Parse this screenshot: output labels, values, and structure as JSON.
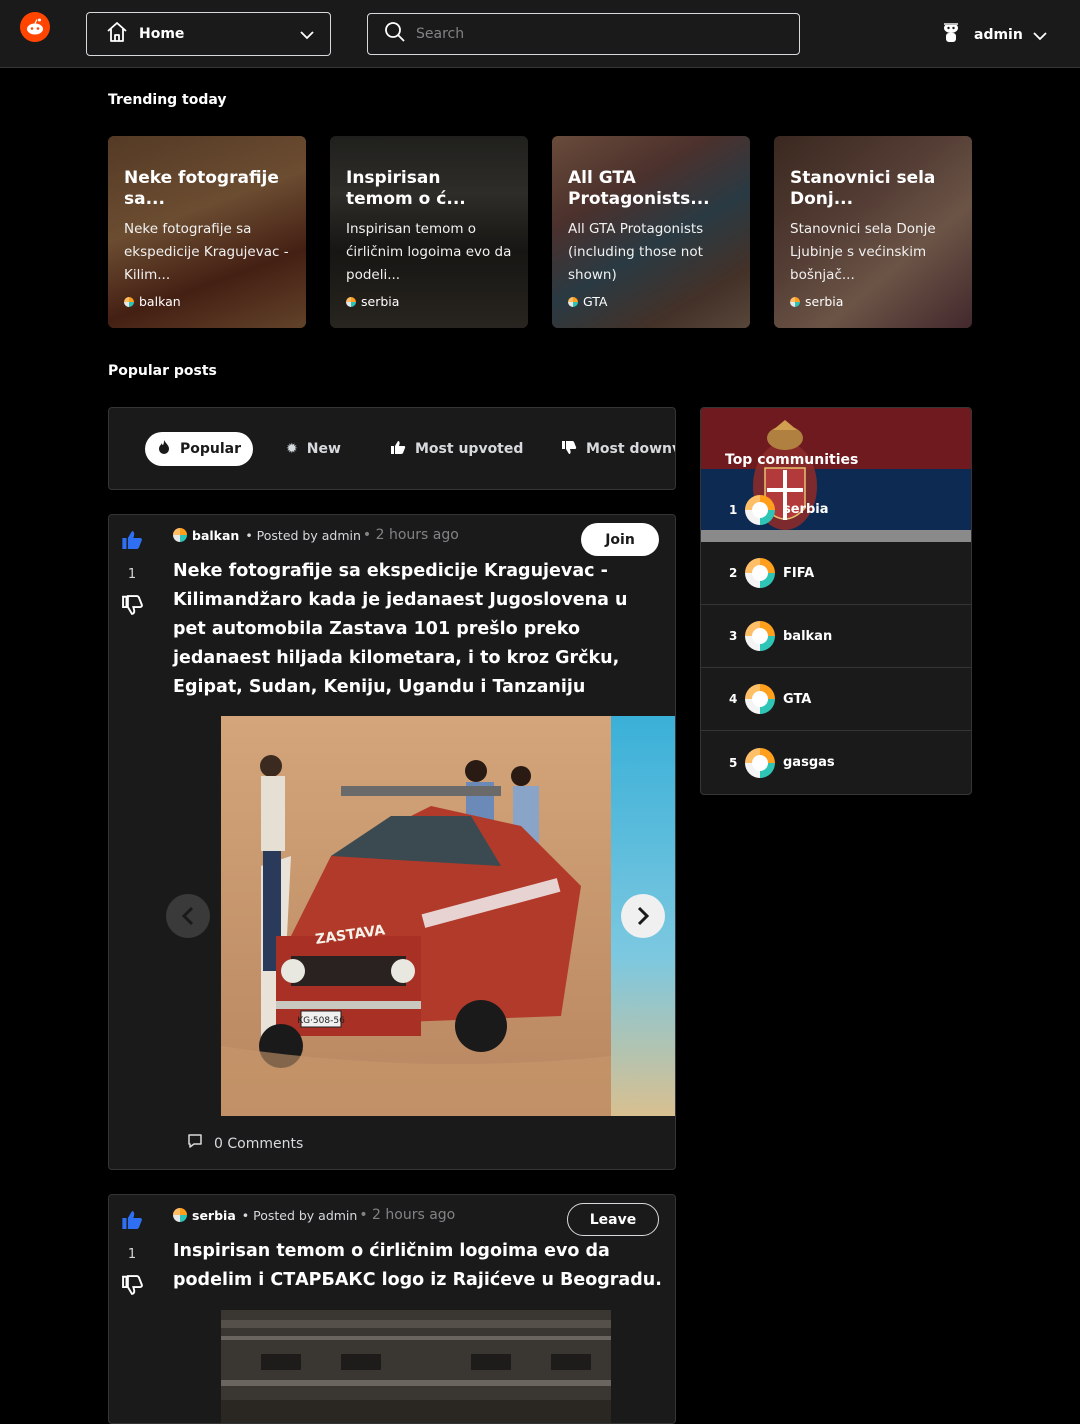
{
  "header": {
    "feed_label": "Home",
    "search_placeholder": "Search",
    "username": "admin"
  },
  "trending": {
    "title": "Trending today",
    "cards": [
      {
        "title": "Neke fotografije sa...",
        "desc": "Neke fotografije sa ekspedicije Kragujevac - Kilim...",
        "sub": "balkan"
      },
      {
        "title": "Inspirisan temom o ć...",
        "desc": "Inspirisan temom o ćirličnim logoima evo da podeli...",
        "sub": "serbia"
      },
      {
        "title": "All GTA Protagonists...",
        "desc": "All GTA Protagonists (including those not shown)",
        "sub": "GTA"
      },
      {
        "title": "Stanovnici sela Donj...",
        "desc": "Stanovnici sela Donje Ljubinje s većinskim bošnjač...",
        "sub": "serbia"
      }
    ]
  },
  "popular": {
    "title": "Popular posts",
    "tabs": [
      "Popular",
      "New",
      "Most upvoted",
      "Most downvoted"
    ]
  },
  "posts": [
    {
      "votes": "1",
      "sub": "balkan",
      "posted_by": "• Posted by admin",
      "time": "• 2 hours ago",
      "button": "Join",
      "title": "Neke fotografije sa ekspedicije Kragujevac - Kilimandžaro kada je jedanaest Jugoslovena u pet automobila Zastava 101 prešlo preko jedanaest hiljada kilometara, i to kroz Grčku, Egipat, Sudan, Keniju, Ugandu i Tanzaniju",
      "comments": "0 Comments",
      "image_text": {
        "car_brand": "ZASTAVA",
        "plate": "KG·508-56"
      }
    },
    {
      "votes": "1",
      "sub": "serbia",
      "posted_by": "• Posted by admin",
      "time": "• 2 hours ago",
      "button": "Leave",
      "title": "Inspirisan temom o ćirličnim logoima evo da podelim i СТАРБАКС logo iz Rajićeve u Beogradu."
    }
  ],
  "sidebar": {
    "title": "Top communities",
    "communities": [
      {
        "rank": "1",
        "name": "serbia"
      },
      {
        "rank": "2",
        "name": "FIFA"
      },
      {
        "rank": "3",
        "name": "balkan"
      },
      {
        "rank": "4",
        "name": "GTA"
      },
      {
        "rank": "5",
        "name": "gasgas"
      }
    ]
  },
  "colors": {
    "brand": "#ff4500",
    "upvote": "#2f6ff2",
    "card_bg": "#1a1a1b",
    "border": "#343536"
  }
}
